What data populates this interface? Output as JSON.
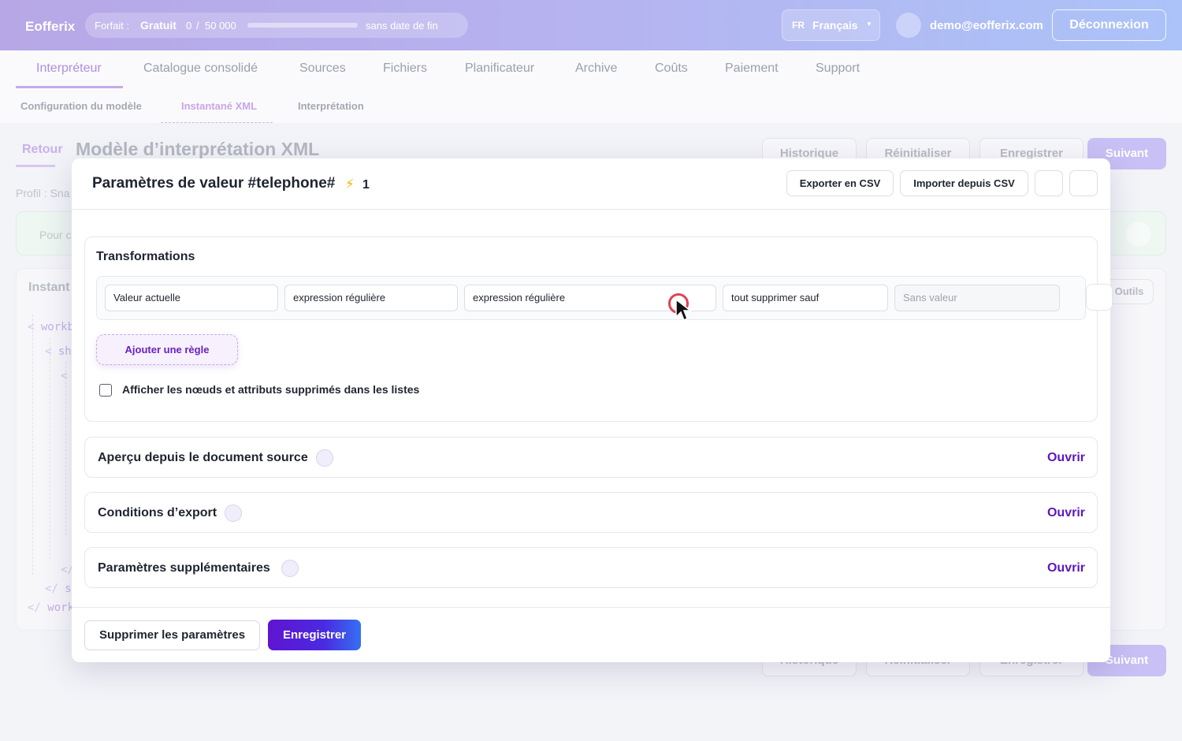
{
  "topbar": {
    "brand": "Eofferix",
    "plan_label": "Forfait :",
    "plan_name": "Gratuit",
    "usage_used": "0",
    "usage_sep": "/",
    "usage_total": "50 000",
    "usage_fraction": 0,
    "plan_expiry": "sans date de fin",
    "lang_code": "FR",
    "lang_name": "Français",
    "email": "demo@eofferix.com",
    "logout": "Déconnexion"
  },
  "nav": {
    "tabs": [
      "Interpréteur",
      "Catalogue consolidé",
      "Sources",
      "Fichiers",
      "Planificateur",
      "Archive",
      "Coûts",
      "Paiement",
      "Support"
    ],
    "subtabs": [
      "Configuration du modèle",
      "Instantané XML",
      "Interprétation"
    ]
  },
  "page": {
    "back": "Retour",
    "title": "Modèle d’interprétation XML",
    "history": "Historique",
    "reset": "Réinitialiser",
    "save": "Enregistrer",
    "next": "Suivant",
    "profile": "Profil : Sna",
    "info": "Pour c",
    "card_title": "Instant",
    "tools": "Outils",
    "code": [
      {
        "p": "<",
        "t": "workb"
      },
      {
        "p": "<",
        "t": "she"
      },
      {
        "p": "<",
        "t": ""
      },
      {
        "p": "</",
        "t": ""
      },
      {
        "p": "</",
        "t": "sl"
      },
      {
        "p": "</",
        "t": "work"
      }
    ]
  },
  "modal": {
    "title": "Paramètres de valeur #telephone#",
    "badge_count": "1",
    "export_csv": "Exporter en CSV",
    "import_csv": "Importer depuis CSV",
    "transformations_title": "Transformations",
    "rules": [
      "Valeur actuelle",
      "expression régulière",
      "expression régulière",
      "tout supprimer sauf"
    ],
    "rule_placeholder": "Sans valeur",
    "add_rule": "Ajouter une règle",
    "show_deleted_label": "Afficher les nœuds et attributs supprimés dans les listes",
    "accordions": [
      {
        "title": "Aperçu depuis le document source",
        "action": "Ouvrir"
      },
      {
        "title": "Conditions d’export",
        "action": "Ouvrir"
      },
      {
        "title": "Paramètres supplémentaires",
        "action": "Ouvrir"
      }
    ],
    "delete_params": "Supprimer les paramètres",
    "save": "Enregistrer"
  },
  "colors": {
    "accent": "#5b17c0",
    "primary_gradient_start": "#6014d0",
    "primary_gradient_end": "#3570f2",
    "bolt": "#f4b400"
  }
}
